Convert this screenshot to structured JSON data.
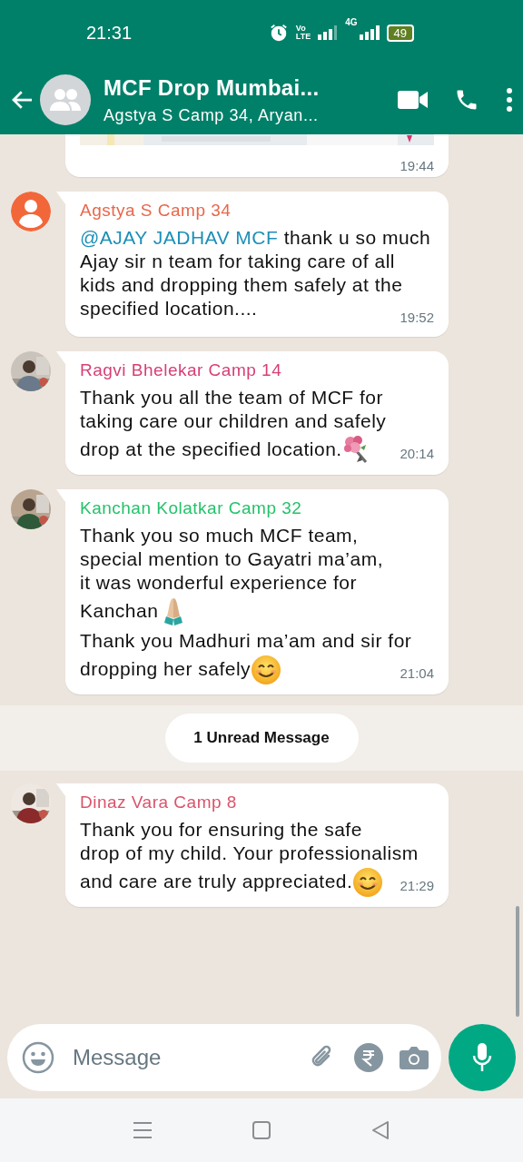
{
  "status_bar": {
    "time": "21:31",
    "volte": [
      "Vo",
      "LTE"
    ],
    "network": "4G",
    "battery": "49"
  },
  "header": {
    "title": "MCF Drop Mumbai...",
    "subtitle": "Agstya S Camp 34, Aryan..."
  },
  "messages": [
    {
      "kind": "location",
      "time": "19:44"
    },
    {
      "kind": "text",
      "sender": "Agstya S Camp 34",
      "color": "#e8674a",
      "avatar": {
        "kind": "icon"
      },
      "paragraphs": [
        {
          "mention": "@AJAY JADHAV MCF",
          "text": " thank u so much\nAjay sir n team for taking care of all\nkids and dropping them safely at the\nspecified location...."
        }
      ],
      "time": "19:52"
    },
    {
      "kind": "text",
      "sender": "Ragvi Bhelekar Camp 14",
      "color": "#d63f75",
      "avatar": {
        "kind": "picture"
      },
      "paragraphs": [
        {
          "text": "Thank you all the team of MCF for\ntaking care our children and safely\ndrop at the specified location.",
          "emoji": {
            "kind": "bouquet"
          }
        }
      ],
      "time": "20:14"
    },
    {
      "kind": "text",
      "sender": "Kanchan Kolatkar Camp 32",
      "color": "#25c26a",
      "avatar": {
        "kind": "picture"
      },
      "paragraphs": [
        {
          "text": "Thank you so much MCF team,\nspecial mention to Gayatri ma’am,\nit was wonderful experience for\nKanchan",
          "emoji": {
            "kind": "folded_hands"
          }
        },
        {
          "text": "Thank you Madhuri ma’am and sir for\ndropping her safely",
          "emoji": {
            "kind": "smile"
          }
        }
      ],
      "time": "21:04"
    },
    {
      "kind": "unread",
      "label": "1 Unread Message"
    },
    {
      "kind": "text",
      "sender": "Dinaz Vara Camp 8",
      "color": "#d9546b",
      "avatar": {
        "kind": "picture"
      },
      "paragraphs": [
        {
          "text": "Thank you for ensuring the safe\ndrop of my child. Your professionalism\nand care are truly appreciated.",
          "emoji": {
            "kind": "smile"
          }
        }
      ],
      "time": "21:29"
    }
  ],
  "composer": {
    "placeholder": "Message"
  }
}
